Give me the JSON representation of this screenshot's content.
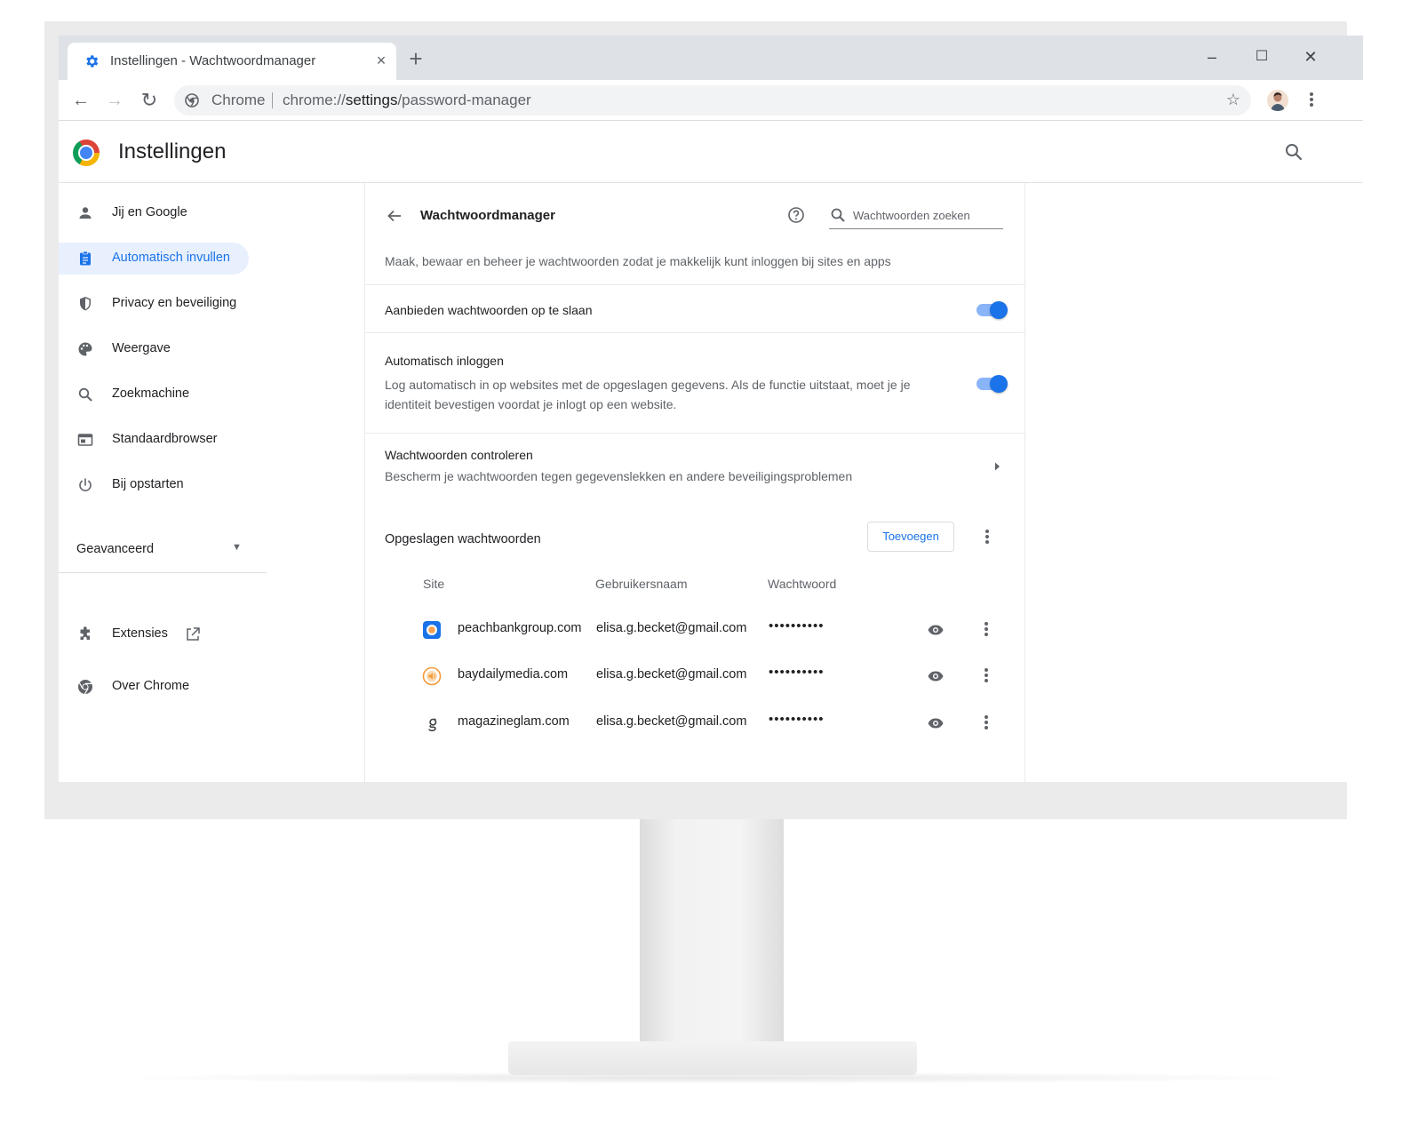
{
  "tab": {
    "title": "Instellingen - Wachtwoordmanager",
    "close": "×",
    "new_tab": "+"
  },
  "window_controls": {
    "minimize": "–",
    "maximize": "☐",
    "close": "✕"
  },
  "toolbar": {
    "back": "←",
    "forward": "→",
    "reload": "↻",
    "chip": "Chrome",
    "url_prefix": "chrome://",
    "url_host": "settings",
    "url_path": "/password-manager",
    "bookmark": "☆"
  },
  "header": {
    "title": "Instellingen"
  },
  "sidebar": {
    "items": [
      {
        "label": "Jij en Google",
        "icon": "person-icon"
      },
      {
        "label": "Automatisch invullen",
        "icon": "clipboard-icon",
        "active": true
      },
      {
        "label": "Privacy en beveiliging",
        "icon": "shield-icon"
      },
      {
        "label": "Weergave",
        "icon": "palette-icon"
      },
      {
        "label": "Zoekmachine",
        "icon": "search-icon"
      },
      {
        "label": "Standaardbrowser",
        "icon": "browser-icon"
      },
      {
        "label": "Bij opstarten",
        "icon": "power-icon"
      }
    ],
    "advanced": "Geavanceerd",
    "advanced_caret": "▼",
    "extensions": "Extensies",
    "about": "Over Chrome"
  },
  "password_manager": {
    "title": "Wachtwoordmanager",
    "search_placeholder": "Wachtwoorden zoeken",
    "description": "Maak, bewaar en beheer je wachtwoorden zodat je makkelijk kunt inloggen bij sites en apps",
    "offer_save": {
      "title": "Aanbieden wachtwoorden op te slaan",
      "enabled": true
    },
    "auto_signin": {
      "title": "Automatisch inloggen",
      "subtitle_line1": "Log automatisch in op websites met de opgeslagen gegevens. Als de functie uitstaat, moet je je",
      "subtitle_line2": "identiteit bevestigen voordat je inlogt op een website.",
      "enabled": true
    },
    "check": {
      "title": "Wachtwoorden controleren",
      "subtitle": "Bescherm je wachtwoorden tegen gegevenslekken en andere beveiligingsproblemen"
    },
    "saved_title": "Opgeslagen wachtwoorden",
    "add_button": "Toevoegen",
    "columns": {
      "site": "Site",
      "username": "Gebruikersnaam",
      "password": "Wachtwoord"
    },
    "rows": [
      {
        "site": "peachbankgroup.com",
        "username": "elisa.g.becket@gmail.com",
        "password": "••••••••••"
      },
      {
        "site": "baydailymedia.com",
        "username": "elisa.g.becket@gmail.com",
        "password": "••••••••••"
      },
      {
        "site": "magazineglam.com",
        "username": "elisa.g.becket@gmail.com",
        "password": "••••••••••"
      }
    ]
  },
  "colors": {
    "accent": "#1a73e8",
    "active_bg": "#e8f0fe",
    "toggle_track": "#8ab4f8"
  }
}
